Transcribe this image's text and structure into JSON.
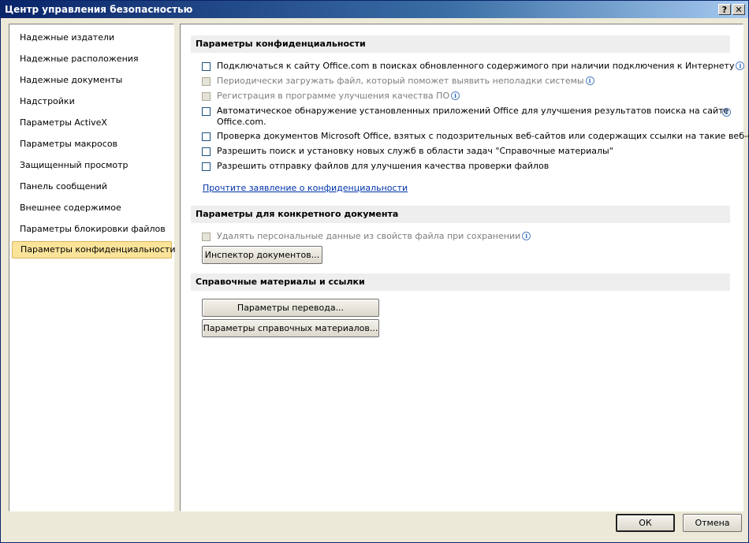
{
  "window": {
    "title": "Центр управления безопасностью",
    "help_label": "?",
    "close_label": "✕"
  },
  "sidebar": {
    "items": [
      {
        "label": "Надежные издатели"
      },
      {
        "label": "Надежные расположения"
      },
      {
        "label": "Надежные документы"
      },
      {
        "label": "Надстройки"
      },
      {
        "label": "Параметры ActiveX"
      },
      {
        "label": "Параметры макросов"
      },
      {
        "label": "Защищенный просмотр"
      },
      {
        "label": "Панель сообщений"
      },
      {
        "label": "Внешнее содержимое"
      },
      {
        "label": "Параметры блокировки файлов"
      },
      {
        "label": "Параметры конфиденциальности",
        "selected": true
      }
    ]
  },
  "privacy": {
    "header": "Параметры конфиденциальности",
    "options": [
      {
        "label": "Подключаться к сайту Office.com в поисках обновленного содержимого при наличии подключения к Интернету",
        "checked": false,
        "disabled": false,
        "info": true
      },
      {
        "label": "Периодически загружать файл, который поможет выявить неполадки системы",
        "checked": false,
        "disabled": true,
        "info": true
      },
      {
        "label": "Регистрация в программе улучшения качества ПО",
        "checked": false,
        "disabled": true,
        "info": true
      },
      {
        "label": "Автоматическое обнаружение установленных приложений Office для улучшения результатов поиска на сайте",
        "label_line2": "Office.com.",
        "checked": false,
        "disabled": false,
        "info": true
      },
      {
        "label": "Проверка документов Microsoft Office, взятых с подозрительных веб-сайтов или содержащих ссылки на такие веб-сайты",
        "checked": false,
        "disabled": false,
        "info": false
      },
      {
        "label": "Разрешить поиск и установку новых служб в области задач \"Справочные материалы\"",
        "checked": false,
        "disabled": false,
        "info": false
      },
      {
        "label": "Разрешить отправку файлов для улучшения качества проверки файлов",
        "checked": false,
        "disabled": false,
        "info": false
      }
    ],
    "statement_link": "Прочтите заявление о конфиденциальности"
  },
  "document": {
    "header": "Параметры для конкретного документа",
    "remove_personal": {
      "label": "Удалять персональные данные из свойств файла при сохранении",
      "checked": false,
      "disabled": true,
      "info": true
    },
    "inspector_button": "Инспектор документов..."
  },
  "references": {
    "header": "Справочные материалы и ссылки",
    "translation_button": "Параметры перевода...",
    "research_button": "Параметры справочных материалов..."
  },
  "footer": {
    "ok_label": "ОК",
    "cancel_label": "Отмена"
  },
  "icons": {
    "info": "info-icon",
    "info_glyph": "i"
  }
}
